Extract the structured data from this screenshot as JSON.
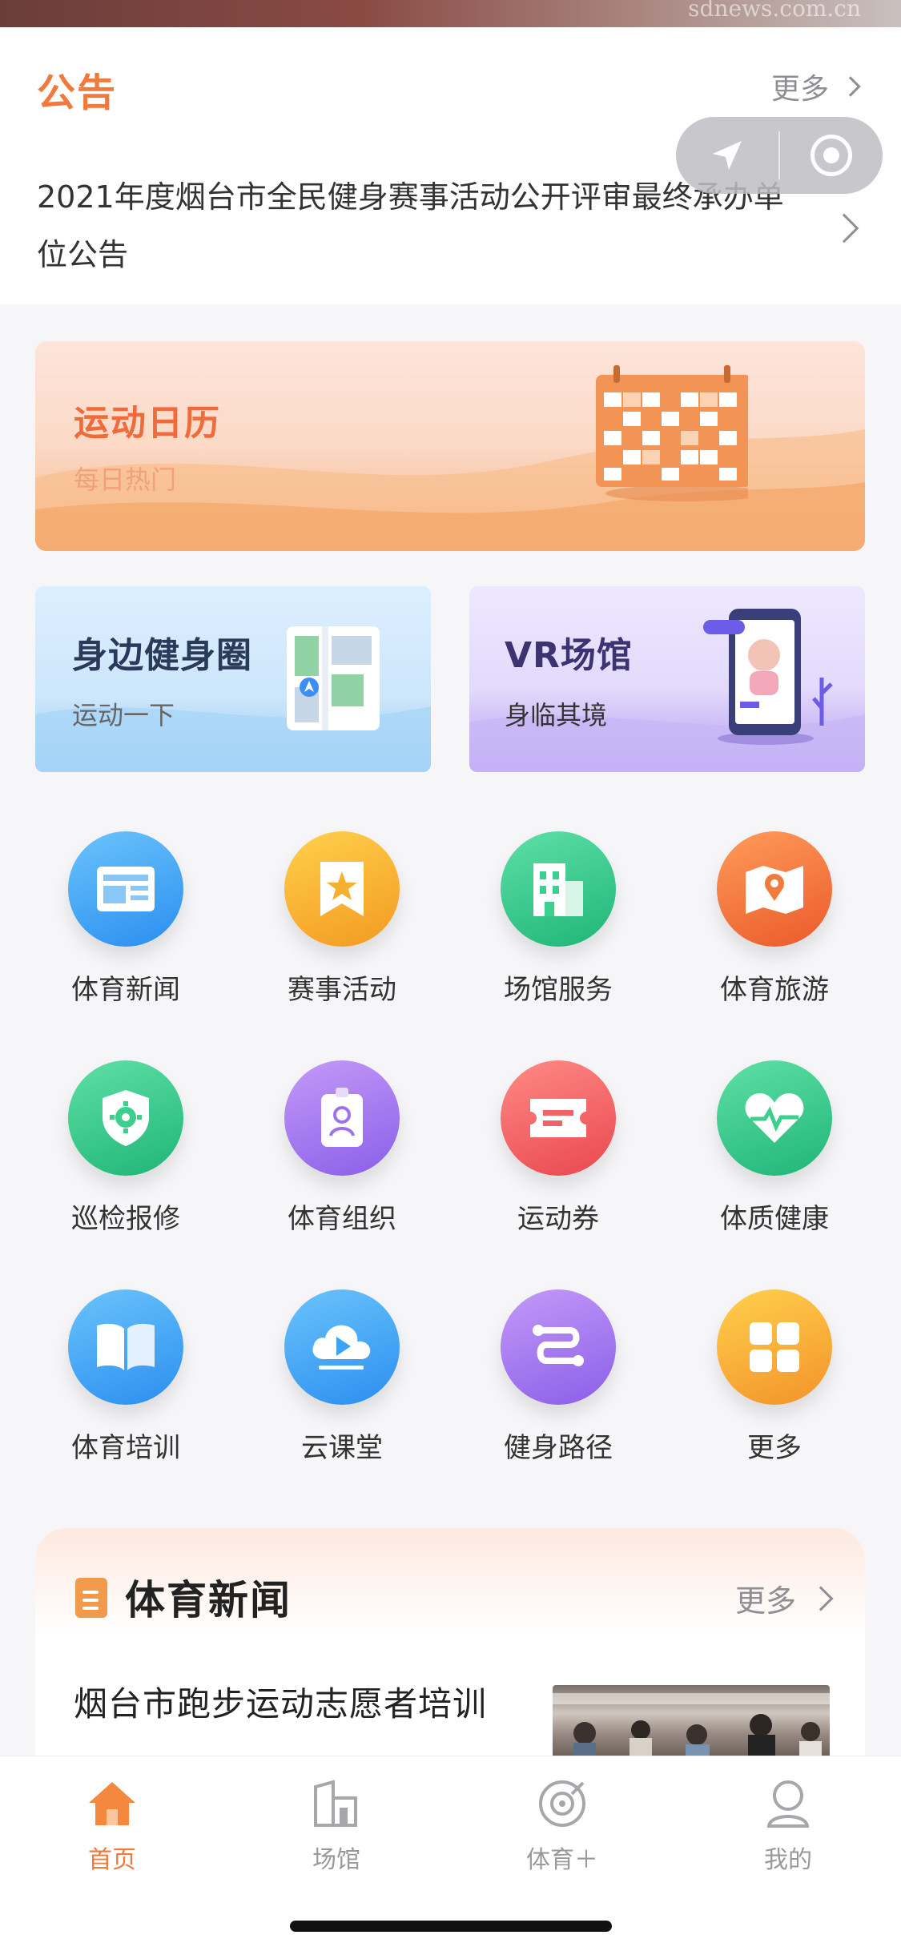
{
  "top_banner": {
    "watermark": "sdnews.com.cn"
  },
  "notice": {
    "title": "公告",
    "more_label": "更多",
    "text": "2021年度烟台市全民健身赛事活动公开评审最终承办单位公告"
  },
  "calendar_banner": {
    "title": "运动日历",
    "subtitle": "每日热门"
  },
  "cards": [
    {
      "title": "身边健身圈",
      "subtitle": "运动一下"
    },
    {
      "title": "VR场馆",
      "subtitle": "身临其境"
    }
  ],
  "grid": {
    "rows": [
      [
        {
          "label": "体育新闻",
          "icon": "news-icon",
          "color": "#3ea3f2"
        },
        {
          "label": "赛事活动",
          "icon": "star-flag-icon",
          "color": "#f7b334"
        },
        {
          "label": "场馆服务",
          "icon": "building-icon",
          "color": "#35c98c"
        },
        {
          "label": "体育旅游",
          "icon": "map-pin-icon",
          "color": "#f37a3c"
        }
      ],
      [
        {
          "label": "巡检报修",
          "icon": "shield-gear-icon",
          "color": "#3cc58d"
        },
        {
          "label": "体育组织",
          "icon": "id-badge-icon",
          "color": "#a277ee"
        },
        {
          "label": "运动券",
          "icon": "ticket-icon",
          "color": "#f06467"
        },
        {
          "label": "体质健康",
          "icon": "heart-pulse-icon",
          "color": "#3cc58d"
        }
      ],
      [
        {
          "label": "体育培训",
          "icon": "book-icon",
          "color": "#3ea3f2"
        },
        {
          "label": "云课堂",
          "icon": "cloud-play-icon",
          "color": "#3ea3f2"
        },
        {
          "label": "健身路径",
          "icon": "route-icon",
          "color": "#a277ee"
        },
        {
          "label": "更多",
          "icon": "grid-more-icon",
          "color": "#f7a93a"
        }
      ]
    ]
  },
  "news": {
    "title": "体育新闻",
    "more_label": "更多",
    "items": [
      {
        "title": "烟台市跑步运动志愿者培训"
      }
    ]
  },
  "tabbar": {
    "items": [
      {
        "label": "首页",
        "icon": "home-icon",
        "active": true
      },
      {
        "label": "场馆",
        "icon": "stadium-icon",
        "active": false
      },
      {
        "label": "体育＋",
        "icon": "target-icon",
        "active": false
      },
      {
        "label": "我的",
        "icon": "user-icon",
        "active": false
      }
    ]
  },
  "colors": {
    "accent": "#f07a3c",
    "text": "#333333",
    "muted": "#8e8e93"
  }
}
